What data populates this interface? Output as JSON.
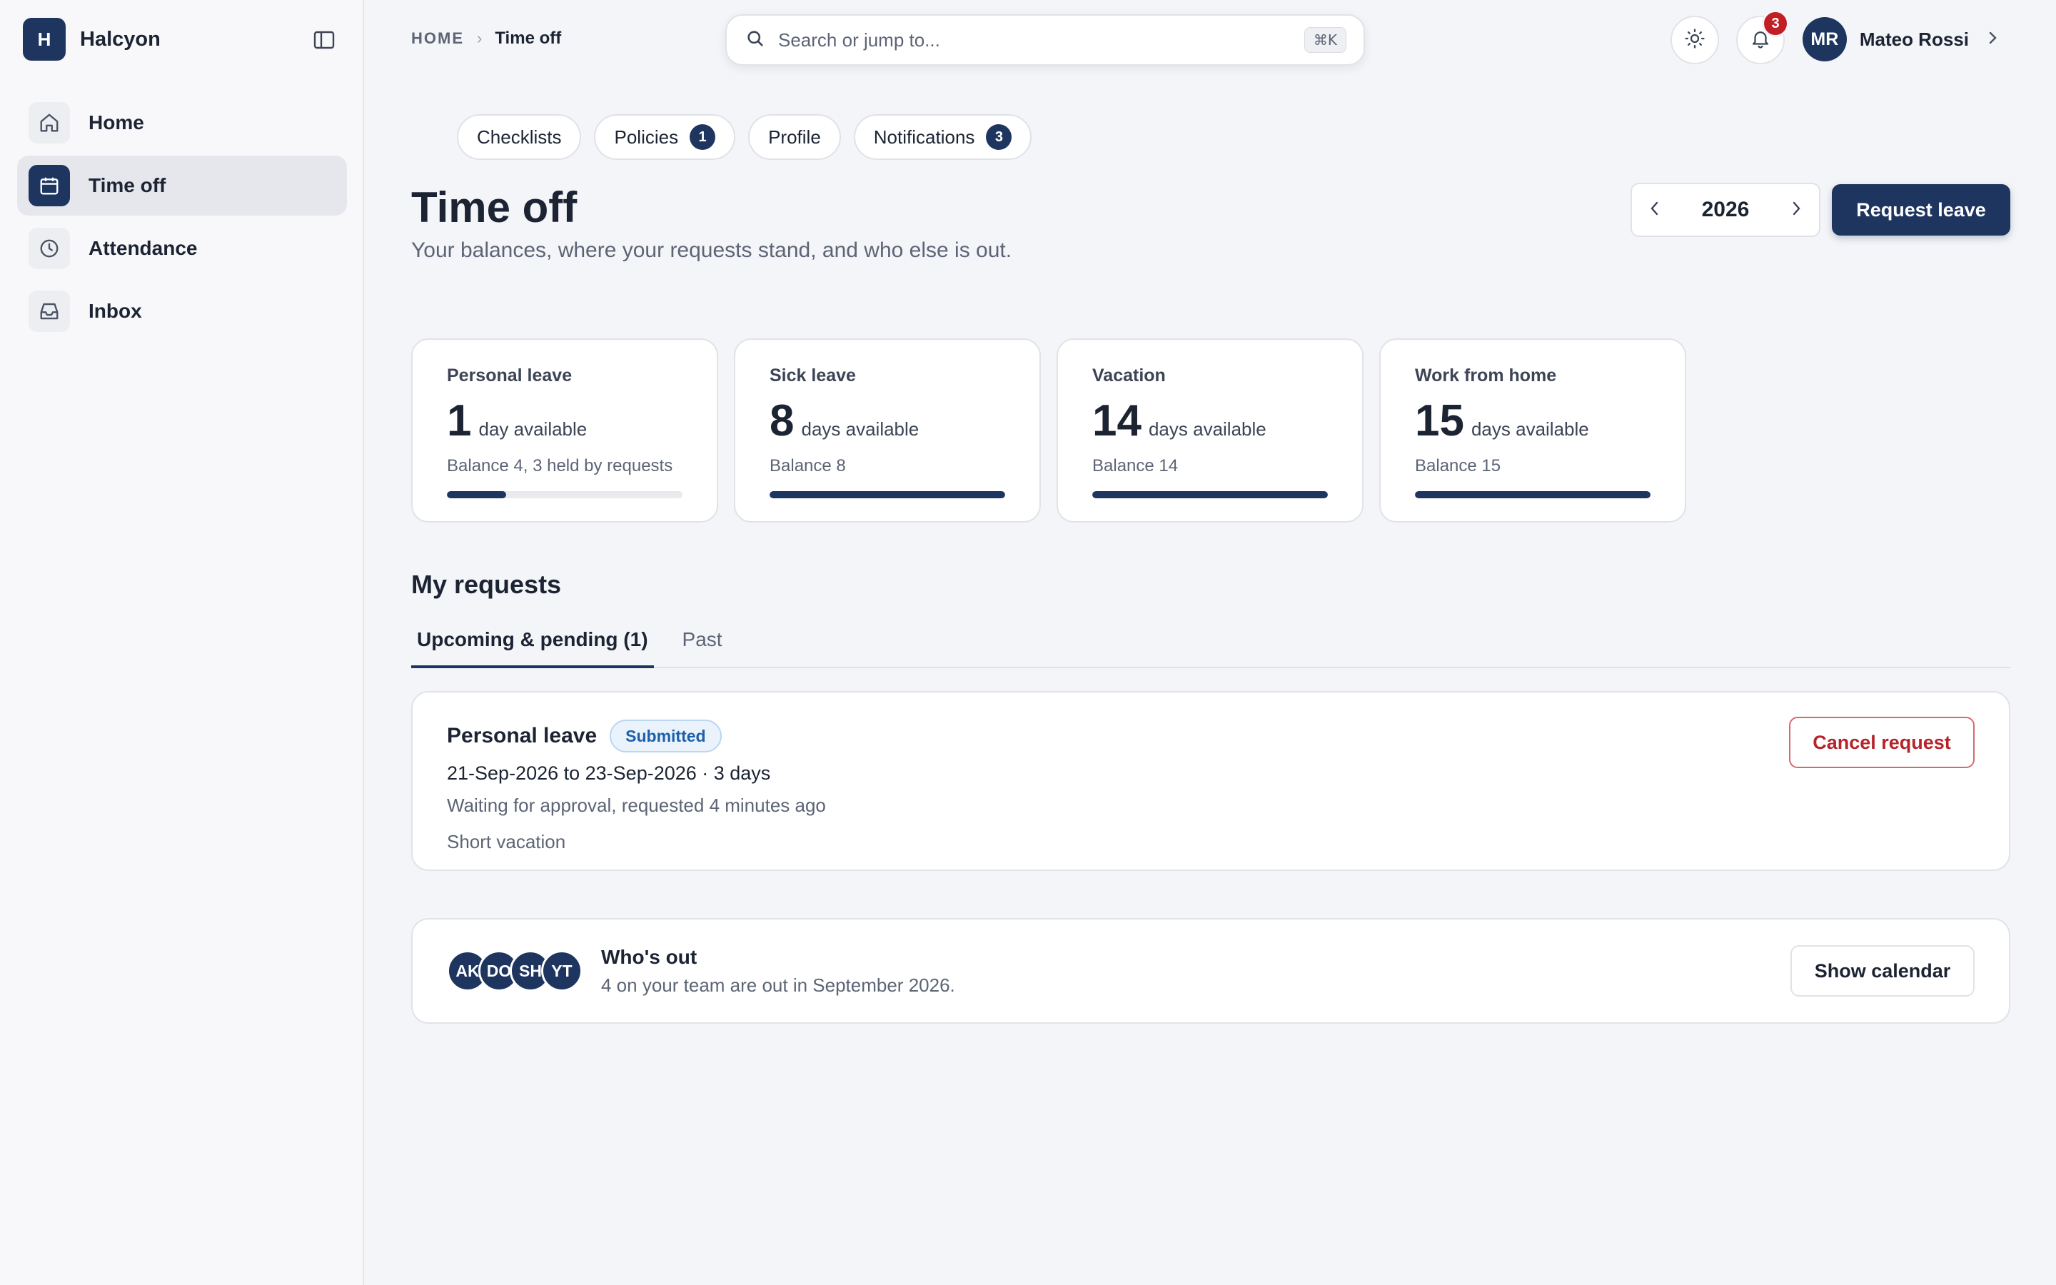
{
  "app": {
    "logo_letter": "H",
    "name": "Halcyon"
  },
  "sidebar": {
    "items": [
      {
        "label": "Home",
        "icon": "home-icon",
        "active": false
      },
      {
        "label": "Time off",
        "icon": "calendar-icon",
        "active": true
      },
      {
        "label": "Attendance",
        "icon": "clock-icon",
        "active": false
      },
      {
        "label": "Inbox",
        "icon": "inbox-icon",
        "active": false
      }
    ]
  },
  "breadcrumb": {
    "home": "HOME",
    "current": "Time off"
  },
  "search": {
    "placeholder": "Search or jump to...",
    "shortcut": "⌘K"
  },
  "header": {
    "notification_count": "3",
    "user": {
      "initials": "MR",
      "name": "Mateo Rossi"
    }
  },
  "chips": [
    {
      "label": "Checklists",
      "count": null
    },
    {
      "label": "Policies",
      "count": "1"
    },
    {
      "label": "Profile",
      "count": null
    },
    {
      "label": "Notifications",
      "count": "3"
    }
  ],
  "page": {
    "title": "Time off",
    "subtitle": "Your balances, where your requests stand, and who else is out.",
    "year": "2026",
    "request_label": "Request leave"
  },
  "balances": [
    {
      "title": "Personal leave",
      "available": "1",
      "unit": "day available",
      "balance_text": "Balance 4, 3 held by requests",
      "fill_fraction": 0.25
    },
    {
      "title": "Sick leave",
      "available": "8",
      "unit": "days available",
      "balance_text": "Balance 8",
      "fill_fraction": 1.0
    },
    {
      "title": "Vacation",
      "available": "14",
      "unit": "days available",
      "balance_text": "Balance 14",
      "fill_fraction": 1.0
    },
    {
      "title": "Work from home",
      "available": "15",
      "unit": "days available",
      "balance_text": "Balance 15",
      "fill_fraction": 1.0
    }
  ],
  "requests": {
    "title": "My requests",
    "tabs": [
      {
        "label": "Upcoming & pending (1)",
        "active": true
      },
      {
        "label": "Past",
        "active": false
      }
    ],
    "items": [
      {
        "type": "Personal leave",
        "status": "Submitted",
        "dates": "21-Sep-2026 to 23-Sep-2026 · 3 days",
        "status_text": "Waiting for approval, requested 4 minutes ago",
        "note": "Short vacation",
        "cancel_label": "Cancel request"
      }
    ]
  },
  "whos_out": {
    "title": "Who's out",
    "subtitle": "4 on your team are out in September 2026.",
    "avatars": [
      "AK",
      "DO",
      "SH",
      "YT"
    ],
    "button_label": "Show calendar"
  },
  "colors": {
    "primary": "#1e3560",
    "danger": "#b5232b",
    "badge_red": "#c11f25",
    "submitted_blue": "#1e5fa8"
  }
}
